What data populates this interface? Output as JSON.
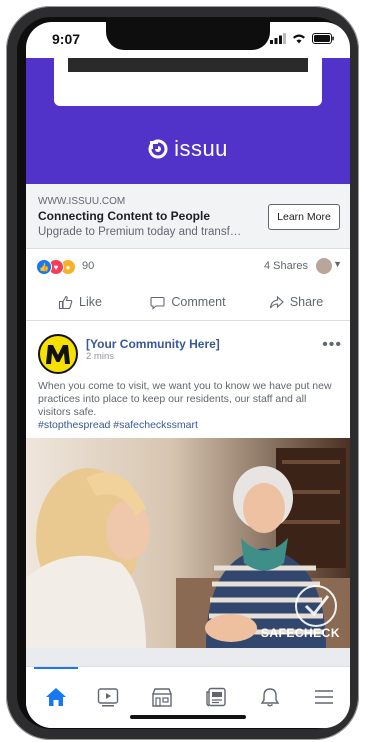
{
  "status_bar": {
    "time": "9:07"
  },
  "ad": {
    "brand": "issuu",
    "url": "WWW.ISSUU.COM",
    "headline": "Connecting Content to People",
    "description": "Upgrade to Premium today and transf…",
    "cta_label": "Learn More",
    "hero_color": "#5133c9"
  },
  "engagement": {
    "reaction_count": "90",
    "shares_label": "4 Shares",
    "reactions": [
      "like",
      "love",
      "wow"
    ]
  },
  "actions": {
    "like": "Like",
    "comment": "Comment",
    "share": "Share"
  },
  "post": {
    "page_name": "[Your Community Here]",
    "time": "2 mins",
    "body": "When you come to visit, we want you to know we have put new practices into place to keep our residents, our staff and all visitors safe.",
    "hashtags": "#stopthespread #safecheckssmart",
    "photo_badge": "SAFECHECK"
  },
  "tabbar": {
    "items": [
      "home-icon",
      "video-icon",
      "marketplace-icon",
      "news-icon",
      "bell-icon",
      "menu-icon"
    ],
    "active": "home-icon",
    "accent": "#1877f2"
  }
}
